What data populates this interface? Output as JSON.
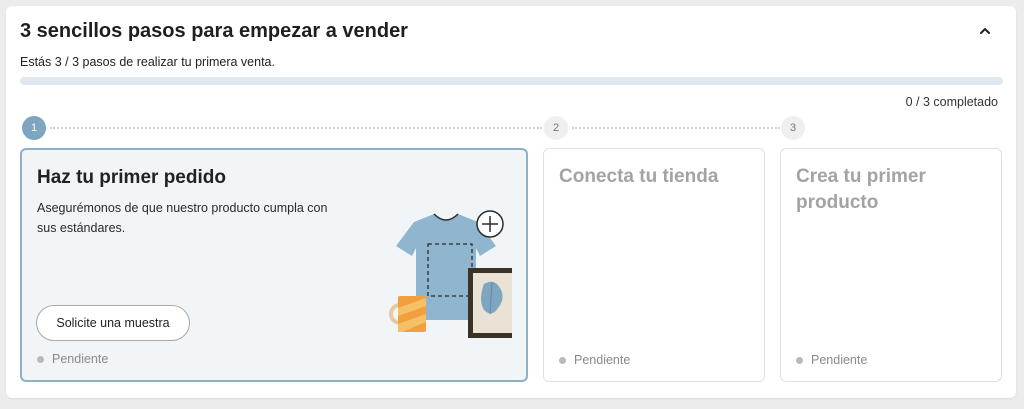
{
  "header": {
    "title": "3 sencillos pasos para empezar a vender",
    "subtitle": "Estás 3 / 3 pasos de realizar tu primera venta.",
    "progress_fraction": 0.0,
    "completed_text": "0 / 3 completado",
    "collapse_icon": "chevron-up-icon"
  },
  "steps": [
    {
      "number": "1",
      "title": "Haz tu primer pedido",
      "description": "Asegurémonos de que nuestro producto cumpla con sus estándares.",
      "button_label": "Solicite una muestra",
      "status": "Pendiente",
      "active": true
    },
    {
      "number": "2",
      "title": "Conecta tu tienda",
      "status": "Pendiente",
      "active": false
    },
    {
      "number": "3",
      "title": "Crea tu primer producto",
      "status": "Pendiente",
      "active": false
    }
  ],
  "colors": {
    "accent": "#7fa6c0",
    "active_card_bg": "#f1f5f7",
    "progress_track": "#dfe8ee"
  }
}
